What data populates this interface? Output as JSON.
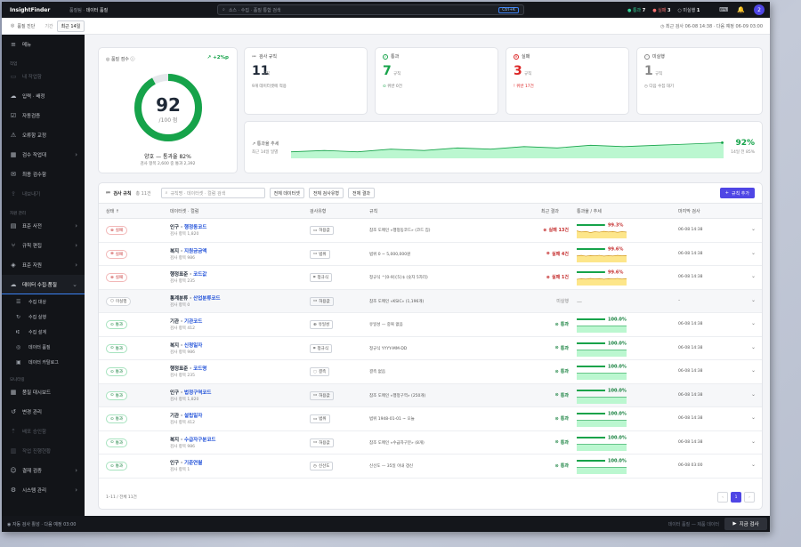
{
  "app": {
    "name": "InsightFinder",
    "breadcrumb_parent": "품질팀",
    "breadcrumb_current": "데이터 품질"
  },
  "search": {
    "placeholder": "소스 · 수집 · 품질 통합 검색",
    "shortcut": "Ctrl+K"
  },
  "top_stats": [
    {
      "label": "통과",
      "value": "7"
    },
    {
      "label": "실패",
      "value": "3"
    },
    {
      "label": "미실행",
      "value": "1"
    }
  ],
  "user_initial": "2",
  "subbar": {
    "button": "품질 진단",
    "period_label": "기간",
    "tabs": [
      "최근 14일"
    ],
    "schedule": "최근 검사 06-08 14:38 · 다음 예정 06-09 03:00"
  },
  "sidebar": {
    "menu_label": "메뉴",
    "section1": "작업",
    "items1": [
      {
        "label": "내 작업함",
        "dim": true
      },
      {
        "label": "입력 · 배정",
        "dim": false
      },
      {
        "label": "자동검증",
        "dim": false
      },
      {
        "label": "오류항 교정",
        "dim": false
      },
      {
        "label": "검수 작업대",
        "dim": false,
        "chev": true
      },
      {
        "label": "최종 검수함",
        "dim": false
      },
      {
        "label": "내보내기",
        "dim": true
      }
    ],
    "section2": "자원 관리",
    "items2": [
      {
        "label": "표준 사전",
        "chev": true
      },
      {
        "label": "규칙 편집",
        "chev": true
      },
      {
        "label": "표준 자원",
        "chev": true
      }
    ],
    "open_item": "데이터 수집·품질",
    "subitems": [
      "수집 대상",
      "수집 실행",
      "수집 설계",
      "데이터 품질",
      "데이터 카탈로그"
    ],
    "section3": "모니터링",
    "items3": [
      {
        "label": "품질 대시보드",
        "dim": false
      },
      {
        "label": "변경 관리",
        "dim": false
      },
      {
        "label": "배포 승인함",
        "dim": true
      },
      {
        "label": "작업 진행현황",
        "dim": true
      },
      {
        "label": "결재 검증",
        "dim": false,
        "chev": true
      },
      {
        "label": "시스템 관리",
        "dim": false,
        "chev": true
      }
    ]
  },
  "score": {
    "title": "품질 점수",
    "trend": "+2%p",
    "value": "92",
    "max": "/100 점",
    "grade": "양호 — 통과율 82%",
    "detail": "검사 항목 2,600 중 통과 2,392",
    "fraction": 0.92
  },
  "kpis": [
    {
      "key": "rules",
      "title": "검사 규칙",
      "value": "11",
      "unit": "규칙",
      "sub": "9개 데이터셋에 적용",
      "color": "#555"
    },
    {
      "key": "pass",
      "title": "통과",
      "value": "7",
      "unit": "규칙",
      "sub": "위반 0건",
      "color": "#16a34a"
    },
    {
      "key": "fail",
      "title": "실패",
      "value": "3",
      "unit": "규칙",
      "sub": "위반 17건",
      "color": "#dc2626"
    },
    {
      "key": "na",
      "title": "미실행",
      "value": "1",
      "unit": "규칙",
      "sub": "다음 수집 대기",
      "color": "#555"
    }
  ],
  "trend": {
    "title": "통과율 추세",
    "subtitle": "최근 14일 일별",
    "value": "92%",
    "delta": "14일 전 85%",
    "points": [
      85,
      86,
      85,
      87,
      86,
      88,
      87,
      89,
      88,
      90,
      89,
      90,
      91,
      92
    ]
  },
  "table": {
    "title": "검사 규칙",
    "count": "총 11건",
    "search_placeholder": "규칙명 · 데이터셋 · 컬럼 검색",
    "filters": [
      "전체 데이터셋",
      "전체 검사유형",
      "전체 결과"
    ],
    "add_label": "규칙 추가",
    "headers": [
      "상태",
      "데이터셋 · 컬럼",
      "검사유형",
      "규칙",
      "최근 결과",
      "통과율 / 추세",
      "마지막 검사"
    ],
    "rows": [
      {
        "status": "실패",
        "status_kind": "fail",
        "dataset": "인구",
        "column": "행정동코드",
        "sub": "검사 항목 1,820",
        "type": "허용값",
        "rule": "참조 도메인 «행정동코드» (코드 집)",
        "result": "실패 13건",
        "result_kind": "fail",
        "rate": "99.3%",
        "pct": 99.3,
        "spark": [
          70,
          60,
          65,
          55,
          62,
          58,
          66,
          60,
          64,
          57,
          63,
          59
        ],
        "last": "06-08 14:38"
      },
      {
        "status": "실패",
        "status_kind": "fail",
        "dataset": "복지",
        "column": "지원금금액",
        "sub": "검사 항목 986",
        "type": "범위",
        "rule": "범위 0 ~ 5,000,000원",
        "result": "실패 4건",
        "result_kind": "fail",
        "rate": "99.6%",
        "pct": 99.6,
        "spark": [
          60,
          66,
          58,
          64,
          61,
          67,
          59,
          63,
          60,
          66,
          62,
          64
        ],
        "last": "06-08 14:38"
      },
      {
        "status": "실패",
        "status_kind": "fail",
        "dataset": "행정표준",
        "column": "코드값",
        "sub": "검사 항목 235",
        "type": "정규식",
        "rule": "정규식 ^[0-9]{5}$ (숫자 5자리)",
        "result": "실패 1건",
        "result_kind": "fail",
        "rate": "99.6%",
        "pct": 99.6,
        "spark": [
          58,
          63,
          60,
          66,
          62,
          65,
          59,
          64,
          61,
          67,
          60,
          65
        ],
        "last": "06-08 14:38"
      },
      {
        "status": "미실행",
        "status_kind": "na",
        "dataset": "통계분류",
        "column": "산업분류코드",
        "sub": "검사 항목 0",
        "type": "허용값",
        "rule": "참조 도메인 «KSIC» (1,196개)",
        "result": "미실행",
        "result_kind": "na",
        "rate": "",
        "pct": null,
        "spark": [],
        "last": "–"
      },
      {
        "status": "통과",
        "status_kind": "pass",
        "dataset": "기관",
        "column": "기관코드",
        "sub": "검사 항목 412",
        "type": "유일성",
        "rule": "유일성 — 중복 없음",
        "result": "통과",
        "result_kind": "pass",
        "rate": "100.0%",
        "pct": 100,
        "spark": [],
        "last": "06-08 14:38"
      },
      {
        "status": "통과",
        "status_kind": "pass",
        "dataset": "복지",
        "column": "신청일자",
        "sub": "검사 항목 986",
        "type": "정규식",
        "rule": "정규식 YYYY-MM-DD",
        "result": "통과",
        "result_kind": "pass",
        "rate": "100.0%",
        "pct": 100,
        "spark": [],
        "last": "06-08 14:38"
      },
      {
        "status": "통과",
        "status_kind": "pass",
        "dataset": "행정표준",
        "column": "코드명",
        "sub": "검사 항목 235",
        "type": "결측",
        "rule": "결측 없음",
        "result": "통과",
        "result_kind": "pass",
        "rate": "100.0%",
        "pct": 100,
        "spark": [],
        "last": "06-08 14:38"
      },
      {
        "status": "통과",
        "status_kind": "pass",
        "dataset": "인구",
        "column": "법정구역코드",
        "sub": "검사 항목 1,820",
        "type": "허용값",
        "rule": "참조 도메인 «행정구역» (250개)",
        "result": "통과",
        "result_kind": "pass",
        "rate": "100.0%",
        "pct": 100,
        "spark": [],
        "last": "06-08 14:38"
      },
      {
        "status": "통과",
        "status_kind": "pass",
        "dataset": "기관",
        "column": "설립일자",
        "sub": "검사 항목 412",
        "type": "범위",
        "rule": "범위 1948-01-01 ~ 오늘",
        "result": "통과",
        "result_kind": "pass",
        "rate": "100.0%",
        "pct": 100,
        "spark": [],
        "last": "06-08 14:38"
      },
      {
        "status": "통과",
        "status_kind": "pass",
        "dataset": "복지",
        "column": "수급자구분코드",
        "sub": "검사 항목 986",
        "type": "허용값",
        "rule": "참조 도메인 «수급자구분» (8개)",
        "result": "통과",
        "result_kind": "pass",
        "rate": "100.0%",
        "pct": 100,
        "spark": [],
        "last": "06-08 14:38"
      },
      {
        "status": "통과",
        "status_kind": "pass",
        "dataset": "인구",
        "column": "기준연월",
        "sub": "검사 항목 1",
        "type": "신선도",
        "rule": "신선도 — 35일 이내 갱신",
        "result": "통과",
        "result_kind": "pass",
        "rate": "100.0%",
        "pct": 100,
        "spark": [],
        "last": "06-08 03:00"
      }
    ],
    "footer": "1–11 / 전체 11건",
    "page": "1"
  },
  "bottom": {
    "left": "자동 검사 활성 · 다음 예정 03:00",
    "right": "데이터 품질 — 제품 데이터",
    "urgent": "지금 검사"
  }
}
